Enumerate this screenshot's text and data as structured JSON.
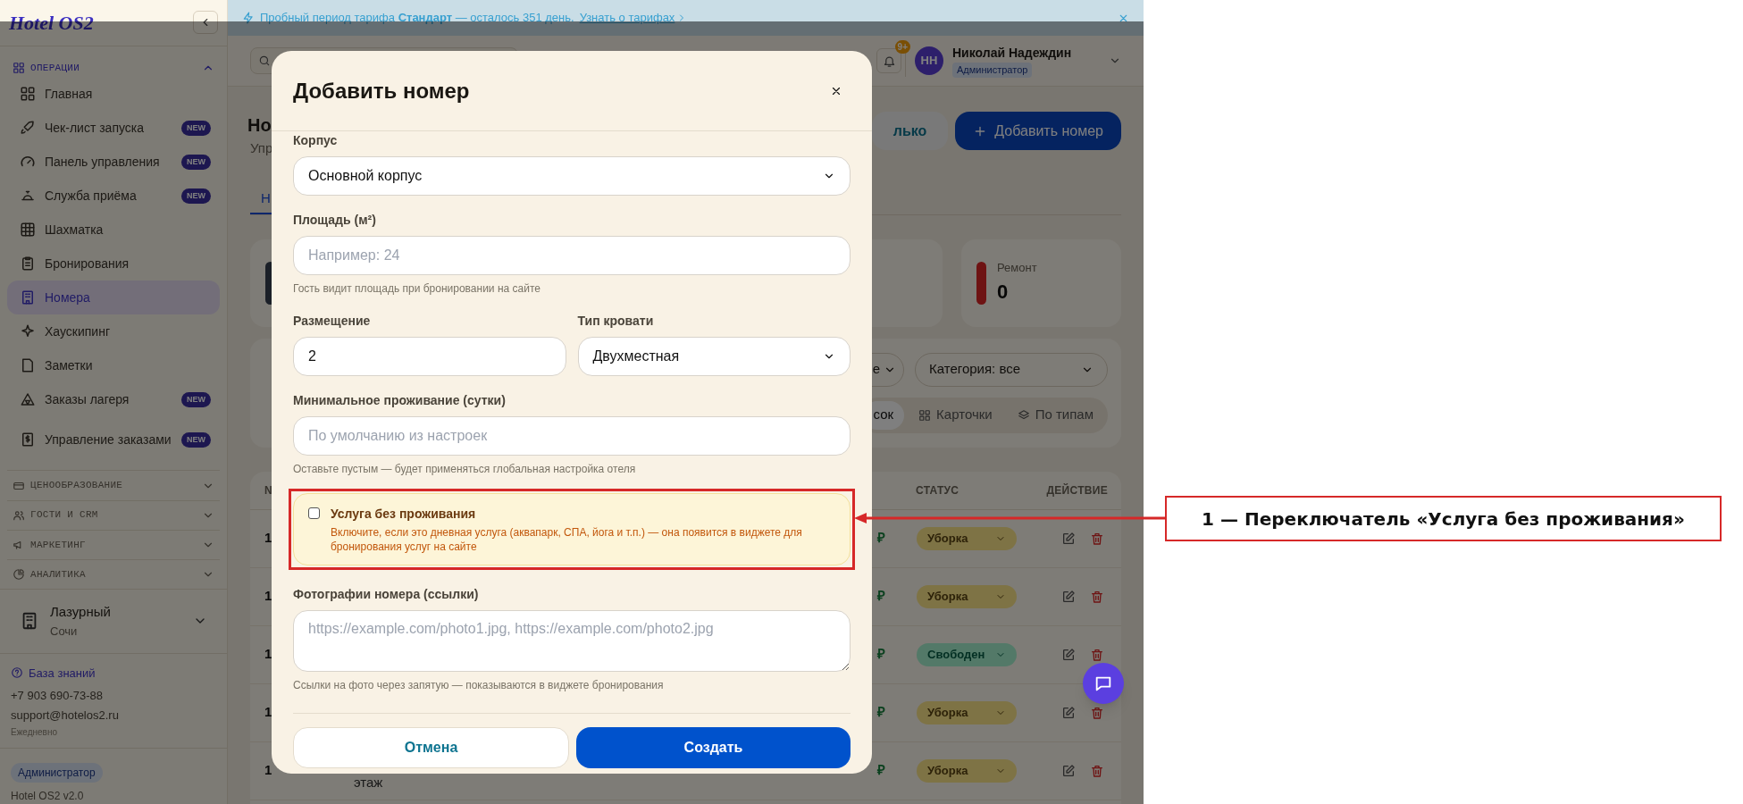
{
  "banner": {
    "text": "Пробный период тарифа **Стандарт** — осталось 351 день.",
    "link": "Узнать о тарифах"
  },
  "sidebar": {
    "logo": "Hotel OS2",
    "sections": [
      {
        "title": "ОПЕРАЦИИ",
        "expanded": true,
        "items": [
          {
            "label": "Главная",
            "selected": false
          },
          {
            "label": "Чек-лист запуска",
            "badge": "NEW",
            "selected": false
          },
          {
            "label": "Панель управления",
            "badge": "NEW",
            "selected": false
          },
          {
            "label": "Служба приёма",
            "badge": "NEW",
            "selected": false
          },
          {
            "label": "Шахматка",
            "selected": false
          },
          {
            "label": "Бронирования",
            "selected": false
          },
          {
            "label": "Номера",
            "selected": true
          },
          {
            "label": "Хаускипинг",
            "selected": false
          },
          {
            "label": "Заметки",
            "selected": false
          },
          {
            "label": "Заказы лагеря",
            "badge": "NEW",
            "selected": false
          },
          {
            "label": "Управление заказами",
            "badge": "NEW",
            "selected": false
          }
        ]
      },
      {
        "title": "ЦЕНООБРАЗОВАНИЕ",
        "expanded": false
      },
      {
        "title": "ГОСТИ И CRM",
        "expanded": false
      },
      {
        "title": "МАРКЕТИНГ",
        "expanded": false
      },
      {
        "title": "АНАЛИТИКА",
        "expanded": false
      }
    ],
    "hotel": {
      "name": "Лазурный",
      "city": "Сочи"
    },
    "help": {
      "link": "База знаний",
      "phone": "+7 903 690-73-88",
      "email": "support@hotelos2.ru",
      "hours": "Ежедневно"
    },
    "role": "Администратор",
    "version": "Hotel OS2 v2.0"
  },
  "topbar": {
    "notifications": "9+",
    "user": {
      "initials": "НН",
      "name": "Николай Надеждин",
      "role": "Администратор"
    }
  },
  "page": {
    "title": "Но",
    "subtitle": "Упр",
    "secondary_button": "лько",
    "primary_button": "Добавить номер",
    "tabs": [
      {
        "label": "Н",
        "selected": true
      }
    ],
    "stats": [
      {
        "kind": "neutral"
      },
      {
        "label": "Ремонт",
        "value": "0",
        "kind": "alert"
      }
    ],
    "filters": {
      "selects": [
        "е",
        "Категория: все"
      ],
      "views": [
        {
          "label": "сок",
          "selected": true
        },
        {
          "label": "Карточки",
          "selected": false
        },
        {
          "label": "По типам",
          "selected": false
        }
      ]
    },
    "table": {
      "columns": [
        "N",
        "СТАТУС",
        "ДЕЙСТВИЕ"
      ],
      "rows": [
        {
          "number": "1",
          "price": "₽",
          "status": "Уборка",
          "kind": "cleaning"
        },
        {
          "number": "1",
          "price": "₽",
          "status": "Уборка",
          "kind": "cleaning"
        },
        {
          "number": "1",
          "price": "₽",
          "status": "Свободен",
          "kind": "free"
        },
        {
          "number": "1",
          "price": "₽",
          "status": "Уборка",
          "kind": "cleaning"
        },
        {
          "number": "1",
          "note": "этаж",
          "price": "₽",
          "status": "Уборка",
          "kind": "cleaning"
        }
      ]
    }
  },
  "modal": {
    "title": "Добавить номер",
    "fields": [
      {
        "kind": "select",
        "label": "Корпус",
        "value": "Основной корпус"
      },
      {
        "kind": "input",
        "label": "Площадь (м²)",
        "placeholder": "Например: 24",
        "hint": "Гость видит площадь при бронировании на сайте"
      },
      {
        "kind": "pair",
        "items": [
          {
            "kind": "input",
            "label": "Размещение",
            "value": "2"
          },
          {
            "kind": "select",
            "label": "Тип кровати",
            "value": "Двухместная"
          }
        ]
      },
      {
        "kind": "input",
        "label": "Минимальное проживание (сутки)",
        "placeholder": "По умолчанию из настроек",
        "hint": "Оставьте пустым — будет применяться глобальная настройка отеля"
      },
      {
        "kind": "checkbox",
        "label": "Услуга без проживания",
        "description": "Включите, если это дневная услуга (аквапарк, СПА, йога и т.п.) — она появится в виджете для бронирования услуг на сайте",
        "checked": false,
        "highlighted": true
      },
      {
        "kind": "textarea",
        "label": "Фотографии номера (ссылки)",
        "placeholder": "https://example.com/photo1.jpg, https://example.com/photo2.jpg",
        "hint": "Ссылки на фото через запятую — показываются в виджете бронирования"
      }
    ],
    "buttons": [
      {
        "label": "Отмена",
        "kind": "secondary"
      },
      {
        "label": "Создать",
        "kind": "primary"
      }
    ]
  },
  "annotation": {
    "text": "1 — Переключатель «Услуга без проживания»"
  }
}
